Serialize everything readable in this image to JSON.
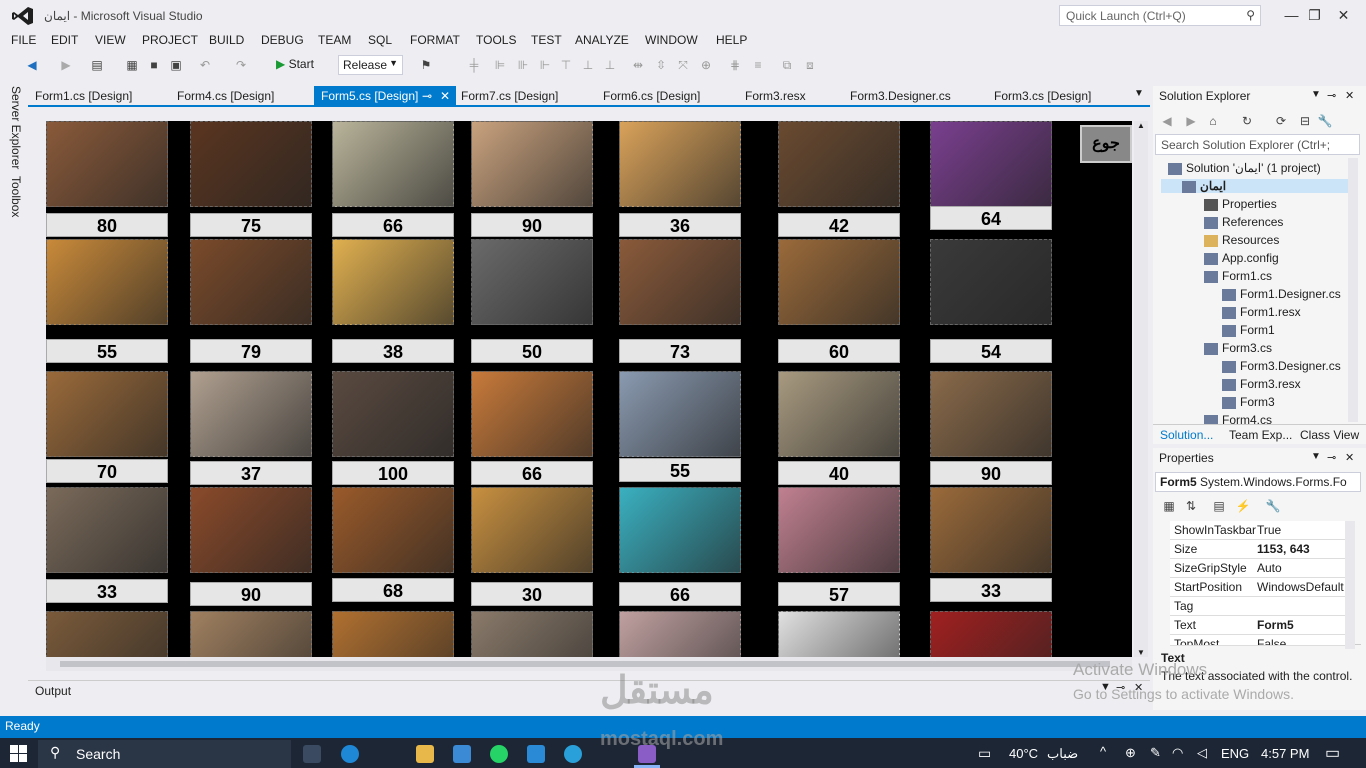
{
  "window": {
    "title": "ايمان - Microsoft Visual Studio",
    "quick_launch_placeholder": "Quick Launch (Ctrl+Q)"
  },
  "menu": [
    "FILE",
    "EDIT",
    "VIEW",
    "PROJECT",
    "BUILD",
    "DEBUG",
    "TEAM",
    "SQL",
    "FORMAT",
    "TOOLS",
    "TEST",
    "ANALYZE",
    "WINDOW",
    "HELP"
  ],
  "toolbar": {
    "start_label": "Start",
    "config": "Release"
  },
  "left_tabs": [
    "Server Explorer",
    "Toolbox"
  ],
  "doc_tabs": [
    {
      "label": "Form1.cs [Design]",
      "active": false
    },
    {
      "label": "Form4.cs [Design]",
      "active": false
    },
    {
      "label": "Form5.cs [Design]",
      "active": true
    },
    {
      "label": "Form7.cs [Design]",
      "active": false
    },
    {
      "label": "Form6.cs [Design]",
      "active": false
    },
    {
      "label": "Form3.resx",
      "active": false
    },
    {
      "label": "Form3.Designer.cs",
      "active": false
    },
    {
      "label": "Form3.cs [Design]",
      "active": false
    }
  ],
  "form": {
    "corner_button": "جوع",
    "rows": [
      [
        {
          "price": "80",
          "color": "#8a5a3a"
        },
        {
          "price": "75",
          "color": "#5a3520"
        },
        {
          "price": "66",
          "color": "#b9b49a"
        },
        {
          "price": "90",
          "color": "#c9a27e"
        },
        {
          "price": "36",
          "color": "#d9a25a"
        },
        {
          "price": "42",
          "color": "#6a4a30"
        },
        {
          "price": "64",
          "color": "#7a3f8f"
        }
      ],
      [
        {
          "price": "55",
          "color": "#c98a3a"
        },
        {
          "price": "79",
          "color": "#7a4a2a"
        },
        {
          "price": "38",
          "color": "#e0b050"
        },
        {
          "price": "50",
          "color": "#6a6a6a"
        },
        {
          "price": "73",
          "color": "#8a5a3a"
        },
        {
          "price": "60",
          "color": "#9a6a3a"
        },
        {
          "price": "54",
          "color": "#3a3a3a"
        }
      ],
      [
        {
          "price": "70",
          "color": "#9a6a3a"
        },
        {
          "price": "37",
          "color": "#b0a090"
        },
        {
          "price": "100",
          "color": "#5a4a40"
        },
        {
          "price": "66",
          "color": "#c87a3a"
        },
        {
          "price": "55",
          "color": "#8a9ab0"
        },
        {
          "price": "40",
          "color": "#a89a80"
        },
        {
          "price": "90",
          "color": "#8a6a4a"
        }
      ],
      [
        {
          "price": "33",
          "color": "#7a6a5a"
        },
        {
          "price": "90",
          "color": "#8a4a2a"
        },
        {
          "price": "68",
          "color": "#9a5a2a"
        },
        {
          "price": "30",
          "color": "#c89040"
        },
        {
          "price": "66",
          "color": "#3ab0c0"
        },
        {
          "price": "57",
          "color": "#c08090"
        },
        {
          "price": "33",
          "color": "#9a6a3a"
        }
      ],
      [
        {
          "price": "",
          "color": "#7a5a3a"
        },
        {
          "price": "",
          "color": "#a08060"
        },
        {
          "price": "",
          "color": "#b07030"
        },
        {
          "price": "",
          "color": "#8a7a6a"
        },
        {
          "price": "",
          "color": "#c0a0a0"
        },
        {
          "price": "",
          "color": "#e0e0e0"
        },
        {
          "price": "",
          "color": "#a02020"
        }
      ]
    ]
  },
  "output_label": "Output",
  "solution_explorer": {
    "title": "Solution Explorer",
    "search_placeholder": "Search Solution Explorer (Ctrl+;",
    "items": [
      {
        "label": "Solution 'ايمان' (1 project)",
        "indent": 0,
        "icon": "solution-icon"
      },
      {
        "label": "ايمان",
        "indent": 1,
        "icon": "csharp-project-icon",
        "bold": true
      },
      {
        "label": "Properties",
        "indent": 2,
        "icon": "wrench-icon"
      },
      {
        "label": "References",
        "indent": 2,
        "icon": "references-icon"
      },
      {
        "label": "Resources",
        "indent": 2,
        "icon": "folder-icon"
      },
      {
        "label": "App.config",
        "indent": 2,
        "icon": "config-icon"
      },
      {
        "label": "Form1.cs",
        "indent": 2,
        "icon": "form-icon"
      },
      {
        "label": "Form1.Designer.cs",
        "indent": 3,
        "icon": "cs-file-icon"
      },
      {
        "label": "Form1.resx",
        "indent": 3,
        "icon": "resx-icon"
      },
      {
        "label": "Form1",
        "indent": 3,
        "icon": "class-icon"
      },
      {
        "label": "Form3.cs",
        "indent": 2,
        "icon": "form-icon"
      },
      {
        "label": "Form3.Designer.cs",
        "indent": 3,
        "icon": "cs-file-icon"
      },
      {
        "label": "Form3.resx",
        "indent": 3,
        "icon": "resx-icon"
      },
      {
        "label": "Form3",
        "indent": 3,
        "icon": "class-icon"
      },
      {
        "label": "Form4.cs",
        "indent": 2,
        "icon": "form-icon"
      }
    ],
    "tabs": [
      "Solution...",
      "Team Exp...",
      "Class View"
    ]
  },
  "properties": {
    "title": "Properties",
    "object": "Form5",
    "object_type": "System.Windows.Forms.Fo",
    "rows": [
      {
        "key": "ShowInTaskbar",
        "value": "True"
      },
      {
        "key": "Size",
        "value": "1153, 643"
      },
      {
        "key": "SizeGripStyle",
        "value": "Auto"
      },
      {
        "key": "StartPosition",
        "value": "WindowsDefault"
      },
      {
        "key": "Tag",
        "value": ""
      },
      {
        "key": "Text",
        "value": "Form5"
      },
      {
        "key": "TopMost",
        "value": "False"
      }
    ],
    "desc_title": "Text",
    "desc_text": "The text associated with the control."
  },
  "status": "Ready",
  "watermark": {
    "line1": "Activate Windows",
    "line2": "Go to Settings to activate Windows.",
    "brand": "مستقل",
    "brand2": "mostaql.com"
  },
  "taskbar": {
    "search": "Search",
    "weather": "40°C",
    "weather_text": "ضباب",
    "lang": "ENG",
    "time": "4:57 PM"
  }
}
